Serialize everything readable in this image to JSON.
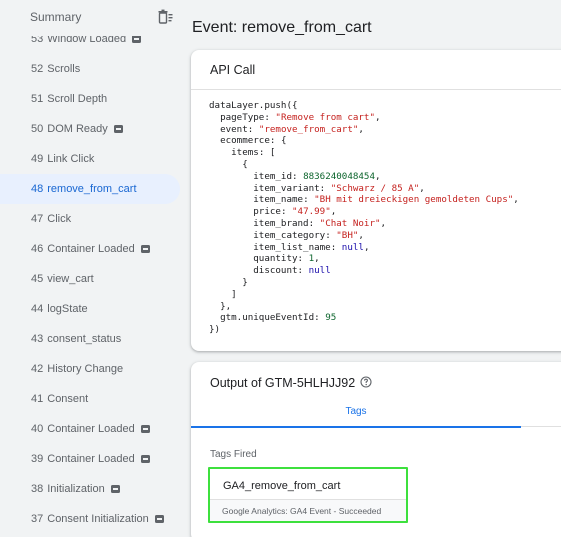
{
  "sidebar": {
    "title": "Summary",
    "items": [
      {
        "num": "53",
        "label": "Window Loaded",
        "badge": true,
        "active": false
      },
      {
        "num": "52",
        "label": "Scrolls",
        "badge": false,
        "active": false
      },
      {
        "num": "51",
        "label": "Scroll Depth",
        "badge": false,
        "active": false
      },
      {
        "num": "50",
        "label": "DOM Ready",
        "badge": true,
        "active": false
      },
      {
        "num": "49",
        "label": "Link Click",
        "badge": false,
        "active": false
      },
      {
        "num": "48",
        "label": "remove_from_cart",
        "badge": false,
        "active": true
      },
      {
        "num": "47",
        "label": "Click",
        "badge": false,
        "active": false
      },
      {
        "num": "46",
        "label": "Container Loaded",
        "badge": true,
        "active": false
      },
      {
        "num": "45",
        "label": "view_cart",
        "badge": false,
        "active": false
      },
      {
        "num": "44",
        "label": "logState",
        "badge": false,
        "active": false
      },
      {
        "num": "43",
        "label": "consent_status",
        "badge": false,
        "active": false
      },
      {
        "num": "42",
        "label": "History Change",
        "badge": false,
        "active": false
      },
      {
        "num": "41",
        "label": "Consent",
        "badge": false,
        "active": false
      },
      {
        "num": "40",
        "label": "Container Loaded",
        "badge": true,
        "active": false
      },
      {
        "num": "39",
        "label": "Container Loaded",
        "badge": true,
        "active": false
      },
      {
        "num": "38",
        "label": "Initialization",
        "badge": true,
        "active": false
      },
      {
        "num": "37",
        "label": "Consent Initialization",
        "badge": true,
        "active": false
      }
    ]
  },
  "main": {
    "title": "Event: remove_from_cart",
    "api_call": {
      "title": "API Call",
      "code": {
        "open": "dataLayer.push({",
        "pageType_key": "pageType",
        "pageType_val": "\"Remove from cart\"",
        "event_key": "event",
        "event_val": "\"remove_from_cart\"",
        "ecommerce_key": "ecommerce",
        "items_key": "items",
        "item_id_key": "item_id",
        "item_id_val": "8836240048454",
        "item_variant_key": "item_variant",
        "item_variant_val": "\"Schwarz / 85 A\"",
        "item_name_key": "item_name",
        "item_name_val": "\"BH mit dreieckigen gemoldeten Cups\"",
        "price_key": "price",
        "price_val": "\"47.99\"",
        "item_brand_key": "item_brand",
        "item_brand_val": "\"Chat Noir\"",
        "item_category_key": "item_category",
        "item_category_val": "\"BH\"",
        "item_list_name_key": "item_list_name",
        "item_list_name_val": "null",
        "quantity_key": "quantity",
        "quantity_val": "1",
        "discount_key": "discount",
        "discount_val": "null",
        "gtm_key": "gtm.uniqueEventId",
        "gtm_val": "95",
        "close": "})"
      }
    },
    "output": {
      "title": "Output of GTM-5HLHJJ92",
      "tab_label": "Tags",
      "tags_fired_label": "Tags Fired",
      "tag": {
        "name": "GA4_remove_from_cart",
        "status": "Google Analytics: GA4 Event - Succeeded"
      }
    }
  },
  "colors": {
    "accent": "#1a73e8",
    "highlight_border": "#3de03d",
    "active_bg": "#e8f0fe",
    "string": "#c5221f",
    "number": "#0d652d"
  }
}
